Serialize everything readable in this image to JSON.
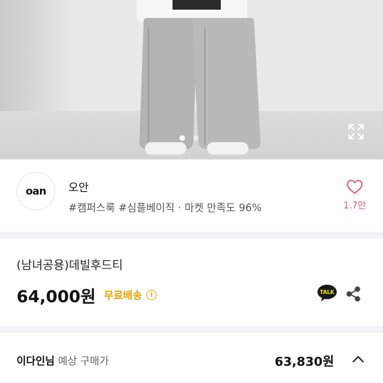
{
  "product_image": {
    "slide_count": 2,
    "active_slide": 1,
    "expand_icon": "expand-icon"
  },
  "shop": {
    "logo_text": "oan",
    "name": "오안",
    "tags": "#캠퍼스룩 #심플베이직 · 마켓 만족도 96%",
    "like_count": "1.7만",
    "like_icon": "heart-outline-icon",
    "like_color": "#e5556e"
  },
  "product": {
    "title": "(남녀공용)데빌후드티",
    "price": "64,000원",
    "shipping_label": "무료배송",
    "shipping_color": "#e8a200",
    "info_icon": "ⓘ",
    "talk_label": "TALK",
    "share_icon": "share-icon"
  },
  "expected": {
    "buyer_name": "이다인님",
    "buyer_label": "예상 구매가",
    "price": "63,830원",
    "toggle_icon": "chevron-up-icon"
  }
}
